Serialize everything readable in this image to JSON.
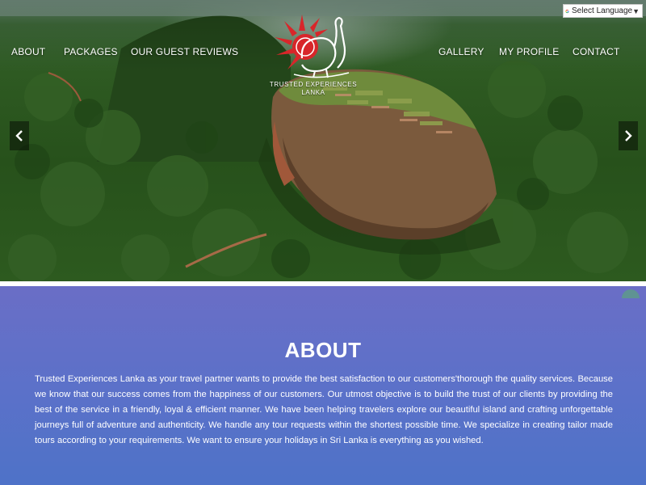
{
  "nav": {
    "left": [
      "ABOUT",
      "PACKAGES",
      "OUR GUEST REVIEWS"
    ],
    "right": [
      "GALLERY",
      "MY PROFILE",
      "CONTACT"
    ]
  },
  "logo": {
    "line1": "TRUSTED EXPERIENCES",
    "line2": "LANKA"
  },
  "language": {
    "label": "Select Language",
    "arrow": "▼"
  },
  "carousel": {
    "prev_icon": "chevron-left-icon",
    "next_icon": "chevron-right-icon"
  },
  "about": {
    "title": "ABOUT",
    "text": "Trusted Experiences Lanka as your travel partner wants to provide the best satisfaction to our customers'thorough the quality services. Because we know that our success comes from the happiness of our customers. Our utmost objective is to build the trust of our clients by providing the best of the service in a friendly, loyal & efficient manner. We have been helping travelers explore our beautiful island and crafting unforgettable journeys full of adventure and authenticity. We handle any tour requests within the shortest possible time. We specialize in creating tailor made tours according to your requirements. We want to ensure your holidays in Sri Lanka is everything as you wished."
  },
  "colors": {
    "about_background": "#5c71c9",
    "logo_sun": "#d8262a",
    "divider": "#ffffff"
  }
}
